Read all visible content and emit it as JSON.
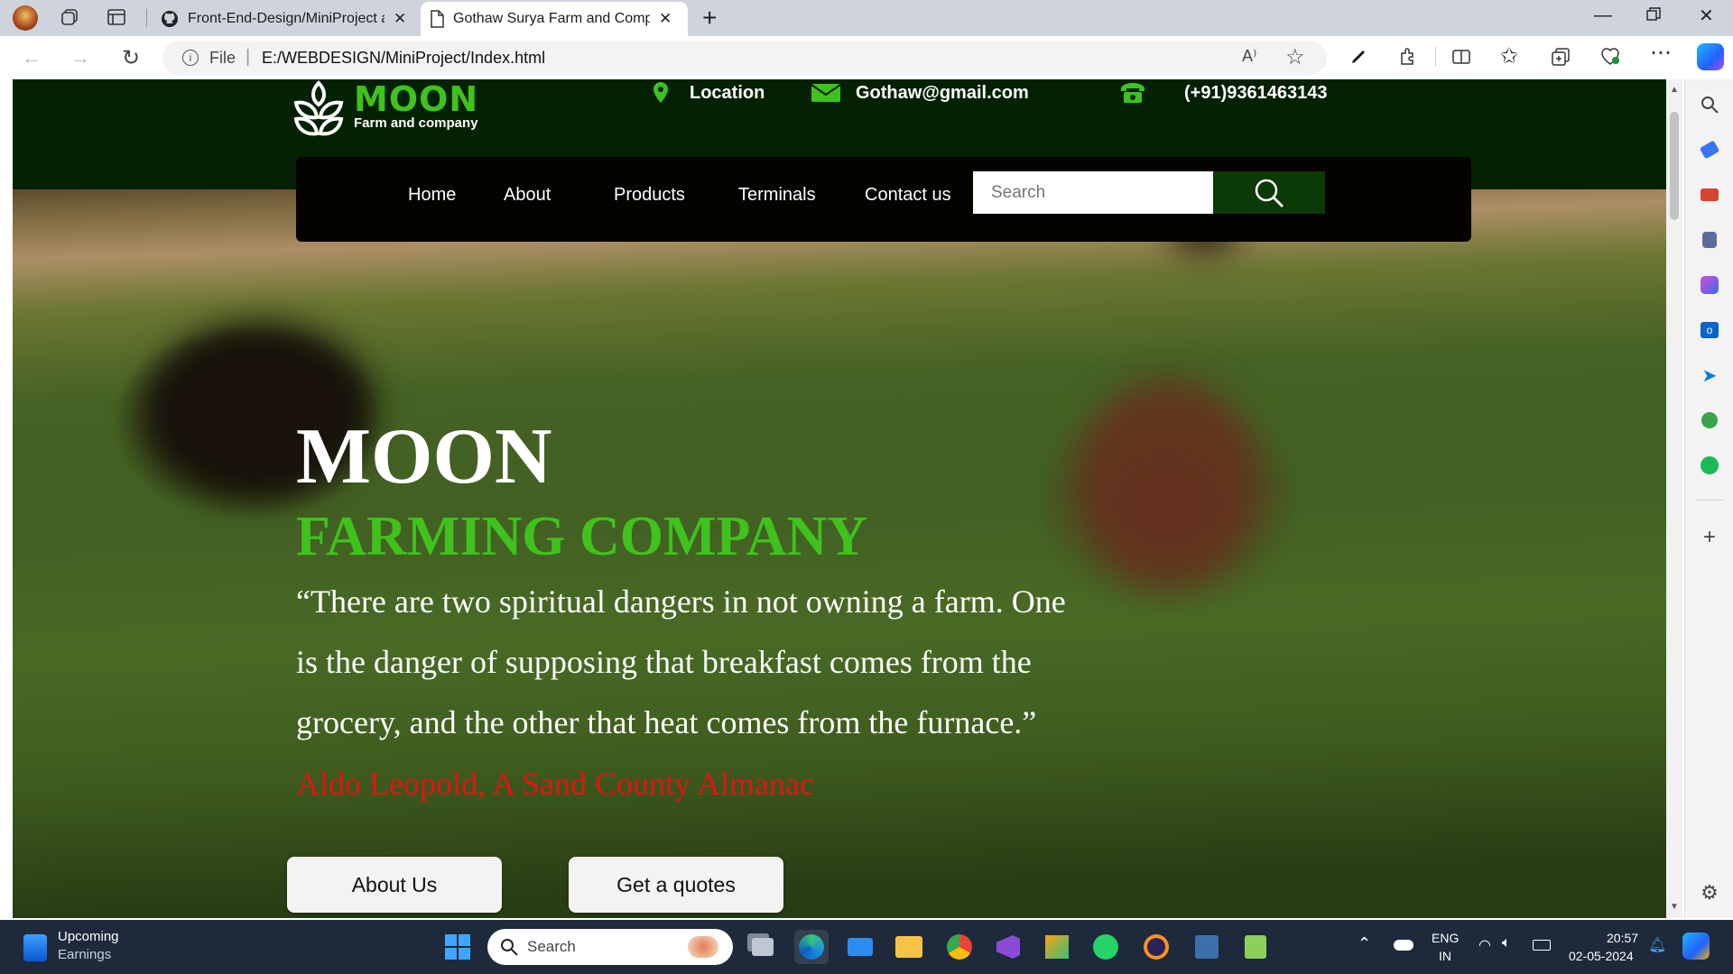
{
  "browser": {
    "tabs": [
      {
        "title": "Front-End-Design/MiniProject at",
        "active": false
      },
      {
        "title": "Gothaw Surya Farm and Company",
        "active": true
      }
    ],
    "address": {
      "scheme_label": "File",
      "url": "E:/WEBDESIGN/MiniProject/Index.html"
    }
  },
  "site": {
    "logo": {
      "name": "MOON",
      "tagline": "Farm and company"
    },
    "contacts": {
      "location": "Location",
      "email": "Gothaw@gmail.com",
      "phone": "(+91)9361463143"
    },
    "nav": [
      "Home",
      "About",
      "Products",
      "Terminals",
      "Contact us"
    ],
    "search_placeholder": "Search",
    "hero": {
      "title": "MOON",
      "subtitle": "FARMING COMPANY",
      "quote_lines": [
        "“There are two spiritual dangers in not owning a farm. One",
        "is the danger of supposing that breakfast comes from the",
        "grocery, and the other that heat comes from the furnace.”"
      ],
      "author": "Aldo Leopold, A Sand County Almanac"
    },
    "buttons": {
      "about": "About Us",
      "quote": "Get a quotes"
    },
    "colors": {
      "header": "#042104",
      "accent_green": "#3fc21d",
      "author_red": "#e3150f",
      "nav_bg": "#050300"
    }
  },
  "taskbar": {
    "widget": {
      "line1": "Upcoming",
      "line2": "Earnings"
    },
    "search_placeholder": "Search",
    "lang": {
      "line1": "ENG",
      "line2": "IN"
    },
    "time": "20:57",
    "date": "02-05-2024"
  }
}
